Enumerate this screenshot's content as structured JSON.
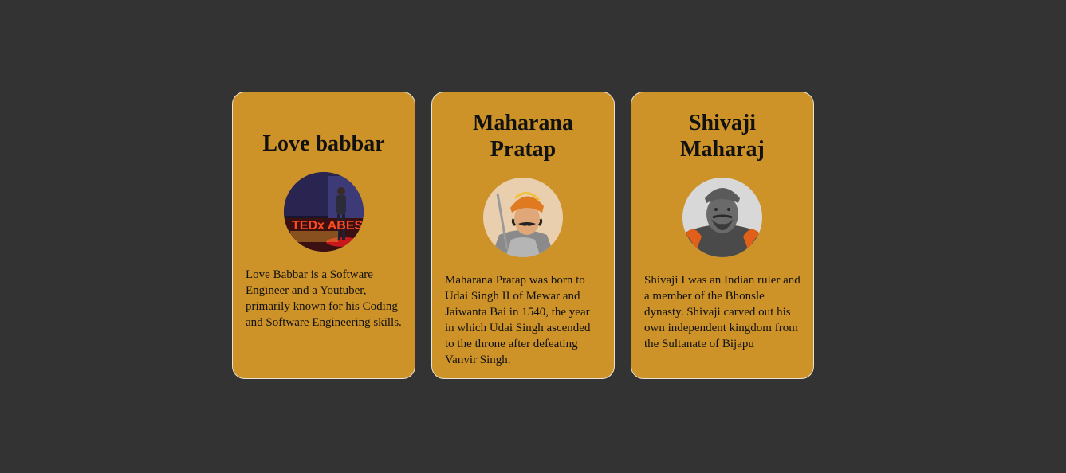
{
  "cards": [
    {
      "title": "Love babbar",
      "image": "love-babbar-photo",
      "description": "Love Babbar is a Software Engineer and a Youtuber, primarily known for his Coding and Software Engineering skills.",
      "image_caption": "TEDx ABES"
    },
    {
      "title": "Maharana Pratap",
      "image": "maharana-pratap-portrait",
      "description": "Maharana Pratap was born to Udai Singh II of Mewar and Jaiwanta Bai in 1540, the year in which Udai Singh ascended to the throne after defeating Vanvir Singh."
    },
    {
      "title": "Shivaji Maharaj",
      "image": "shivaji-maharaj-statue",
      "description": "Shivaji I was an Indian ruler and a member of the Bhonsle dynasty. Shivaji carved out his own independent kingdom from the Sultanate of Bijapu"
    }
  ],
  "colors": {
    "background": "#333333",
    "card": "#cd9228",
    "card_border": "#e8e2d4"
  }
}
